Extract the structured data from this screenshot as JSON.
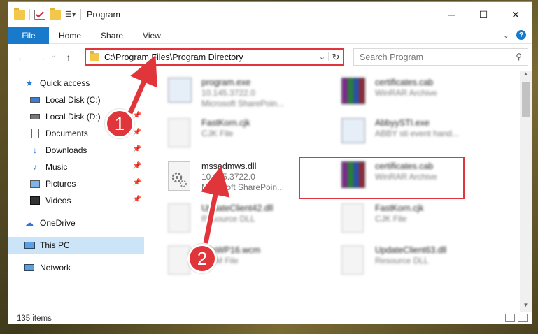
{
  "window": {
    "title": "Program",
    "minimize_glyph": "─",
    "maximize_glyph": "☐",
    "close_glyph": "✕"
  },
  "ribbon": {
    "file": "File",
    "tabs": [
      "Home",
      "Share",
      "View"
    ],
    "accent": "#1979ca"
  },
  "address": {
    "path": "C:\\Program Files\\Program Directory"
  },
  "search": {
    "placeholder": "Search Program"
  },
  "navpane": {
    "items": [
      {
        "label": "Quick access",
        "icon": "star-icon"
      },
      {
        "label": "Local Disk (C:)",
        "icon": "drive-icon"
      },
      {
        "label": "Local Disk (D:)",
        "icon": "drive-icon"
      },
      {
        "label": "Documents",
        "icon": "documents-icon"
      },
      {
        "label": "Downloads",
        "icon": "download-icon"
      },
      {
        "label": "Music",
        "icon": "music-icon"
      },
      {
        "label": "Pictures",
        "icon": "pictures-icon"
      },
      {
        "label": "Videos",
        "icon": "videos-icon"
      },
      {
        "label": "OneDrive",
        "icon": "cloud-icon"
      },
      {
        "label": "This PC",
        "icon": "computer-icon"
      },
      {
        "label": "Network",
        "icon": "network-icon"
      }
    ]
  },
  "files": [
    {
      "name": "program.exe",
      "line1": "10.145.3722.0",
      "line2": "Microsoft SharePoin..."
    },
    {
      "name": "certificates.cab",
      "line1": "WinRAR Archive",
      "line2": ""
    },
    {
      "name": "FastKorn.cjk",
      "line1": "CJK File",
      "line2": ""
    },
    {
      "name": "AbbyySTI.exe",
      "line1": "ABBY sti event hand...",
      "line2": ""
    },
    {
      "name": "mssadmws.dll",
      "line1": "10.145.3722.0",
      "line2": "Microsoft SharePoin..."
    },
    {
      "name": "certificates.cab",
      "line1": "WinRAR Archive",
      "line2": ""
    },
    {
      "name": "UpdateClient42.dll",
      "line1": "Resource DLL",
      "line2": ""
    },
    {
      "name": "FastKorn.cjk",
      "line1": "CJK File",
      "line2": ""
    },
    {
      "name": "InfoWP16.wcm",
      "line1": "WCM File",
      "line2": ""
    },
    {
      "name": "UpdateClient63.dll",
      "line1": "Resource DLL",
      "line2": ""
    }
  ],
  "status": {
    "items_count": "135 items"
  },
  "annotations": {
    "step1": "1",
    "step2": "2",
    "color": "#e0353a"
  }
}
